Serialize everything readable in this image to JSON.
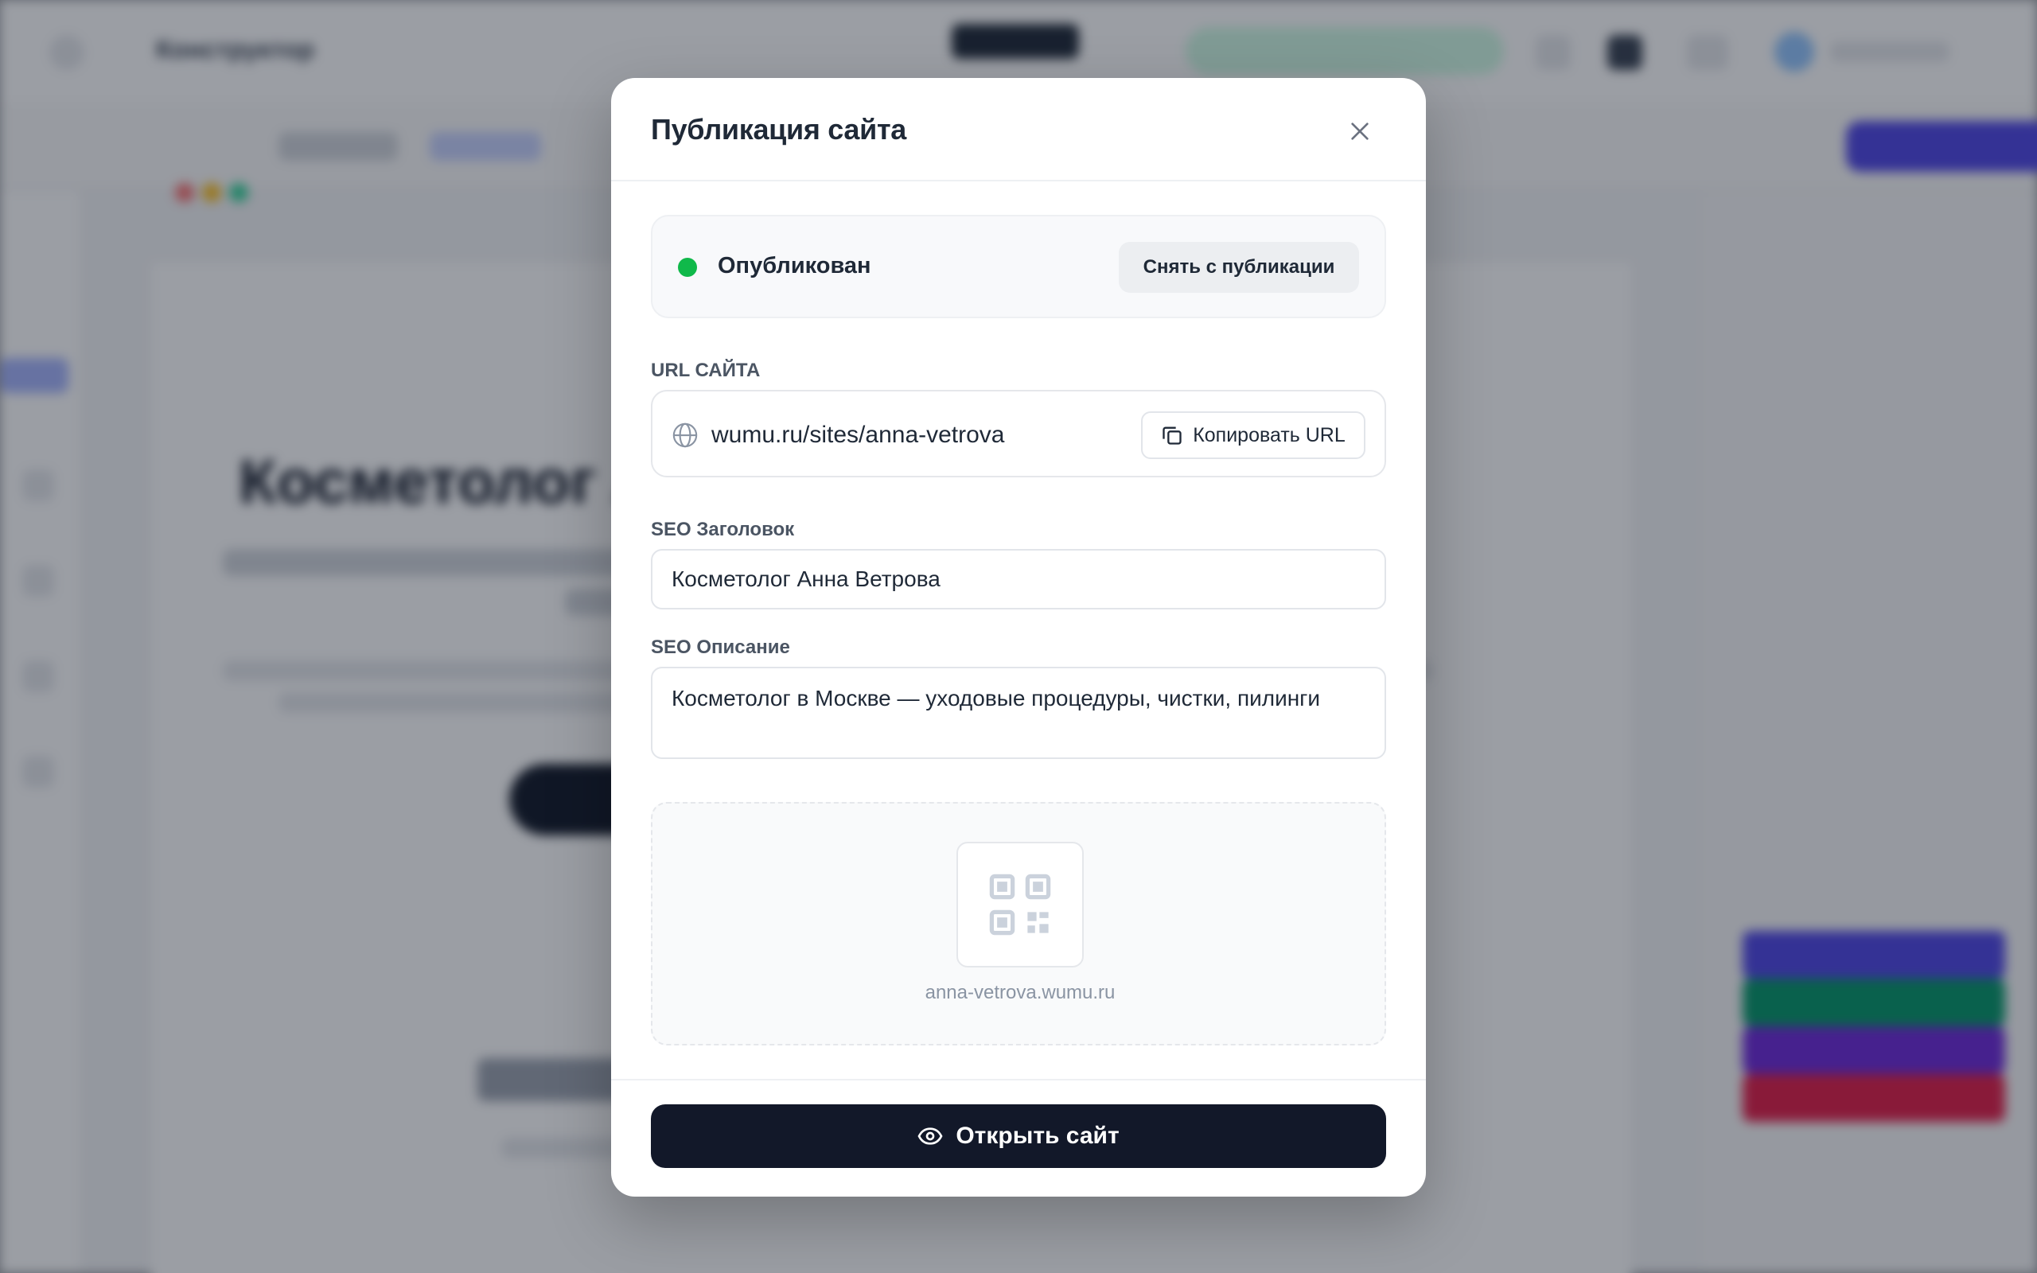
{
  "modal": {
    "title": "Публикация сайта",
    "status": {
      "label": "Опубликован",
      "color": "#10b94a",
      "unpublish_label": "Снять с публикации"
    },
    "url_section": {
      "label": "URL САЙТА",
      "url": "wumu.ru/sites/anna-vetrova",
      "copy_label": "Копировать URL"
    },
    "seo_title": {
      "label": "SEO Заголовок",
      "value": "Косметолог Анна Ветрова"
    },
    "seo_description": {
      "label": "SEO Описание",
      "value": "Косметолог в Москве — уходовые процедуры, чистки, пилинги"
    },
    "qr": {
      "icon": "qr-code-icon",
      "caption": "anna-vetrova.wumu.ru"
    },
    "footer": {
      "open_label": "Открыть сайт",
      "button_color": "#121829"
    }
  },
  "background": {
    "app_name": "Конструктор",
    "hero_title": "Косметолог Анна Ветрова"
  }
}
